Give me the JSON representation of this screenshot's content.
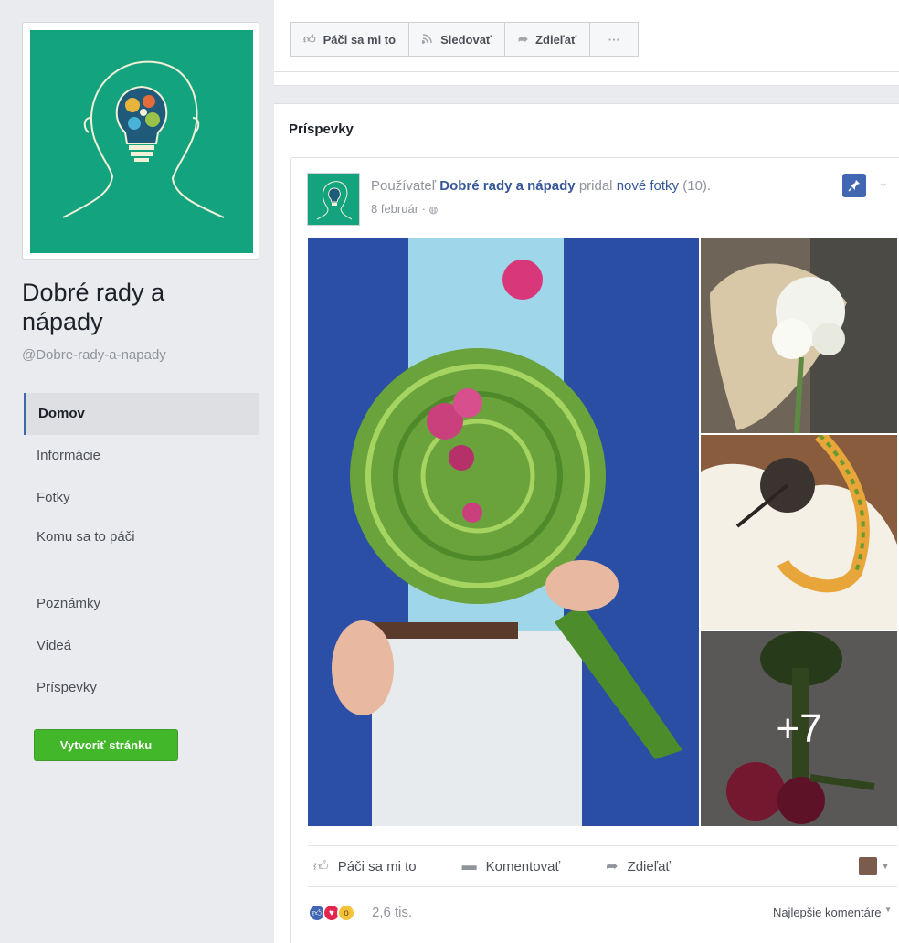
{
  "page": {
    "name": "Dobré rady a nápady",
    "handle": "@Dobre-rady-a-napady"
  },
  "nav": {
    "items": [
      "Domov",
      "Informácie",
      "Fotky",
      "Komu sa to páči",
      "Poznámky",
      "Videá",
      "Príspevky"
    ],
    "active": "Domov"
  },
  "create_page_label": "Vytvoriť stránku",
  "top_actions": {
    "like": "Páči sa mi to",
    "follow": "Sledovať",
    "share": "Zdieľať",
    "more": "···"
  },
  "posts": {
    "section_title": "Príspevky",
    "post": {
      "header_prefix": "Používateľ",
      "author": "Dobré rady a nápady",
      "action": "pridal",
      "photos_link": "nové fotky",
      "photo_count": "(10).",
      "date": "8 február ·",
      "more_photos": "+7",
      "actions": {
        "like": "Páči sa mi to",
        "comment": "Komentovať",
        "share": "Zdieľať"
      },
      "reaction_count": "2,6 tis.",
      "top_comments": "Najlepšie komentáre"
    }
  },
  "colors": {
    "brand_green": "#14a37f",
    "link_blue": "#365899",
    "pin_blue": "#4267b2",
    "create_green": "#42b72a"
  }
}
